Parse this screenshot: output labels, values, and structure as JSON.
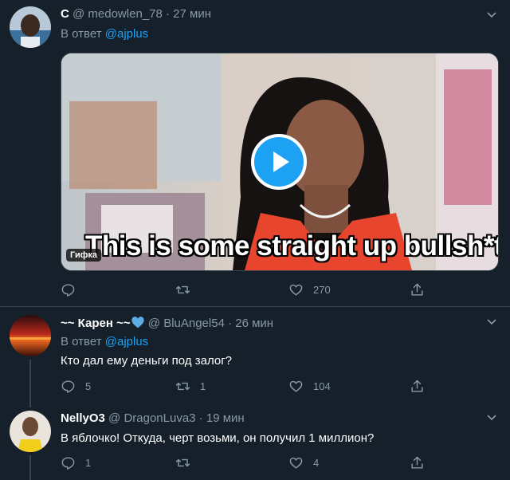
{
  "tweets": [
    {
      "display_name": "C",
      "handle": "@ medowlen_78",
      "time": "27 мин",
      "reply_prefix": "В ответ",
      "reply_to": "@ajplus",
      "media": {
        "type": "gif",
        "caption": "This is some straight up bullsh*t",
        "badge": "Гифка"
      },
      "actions": {
        "reply": "",
        "retweet": "",
        "like": "270"
      }
    },
    {
      "display_name": "~~ Карен ~~",
      "handle": "@ BluAngel54",
      "time": "26 мин",
      "reply_prefix": "В ответ",
      "reply_to": "@ajplus",
      "text": "Кто дал ему деньги под залог?",
      "actions": {
        "reply": "5",
        "retweet": "1",
        "like": "104"
      }
    },
    {
      "display_name": "NellyO3",
      "handle": "@ DragonLuva3",
      "time": "19 мин",
      "text": "В яблочко! Откуда, черт возьми, он получил 1 миллион?",
      "actions": {
        "reply": "1",
        "retweet": "",
        "like": "4"
      }
    }
  ],
  "colors": {
    "background": "#15202b",
    "secondary_text": "#8899a6",
    "accent": "#1da1f2",
    "heart_emoji": "#5dade2"
  },
  "icons": [
    "reply-icon",
    "retweet-icon",
    "like-icon",
    "share-icon",
    "caret-down-icon",
    "play-icon",
    "blue-heart-icon"
  ]
}
